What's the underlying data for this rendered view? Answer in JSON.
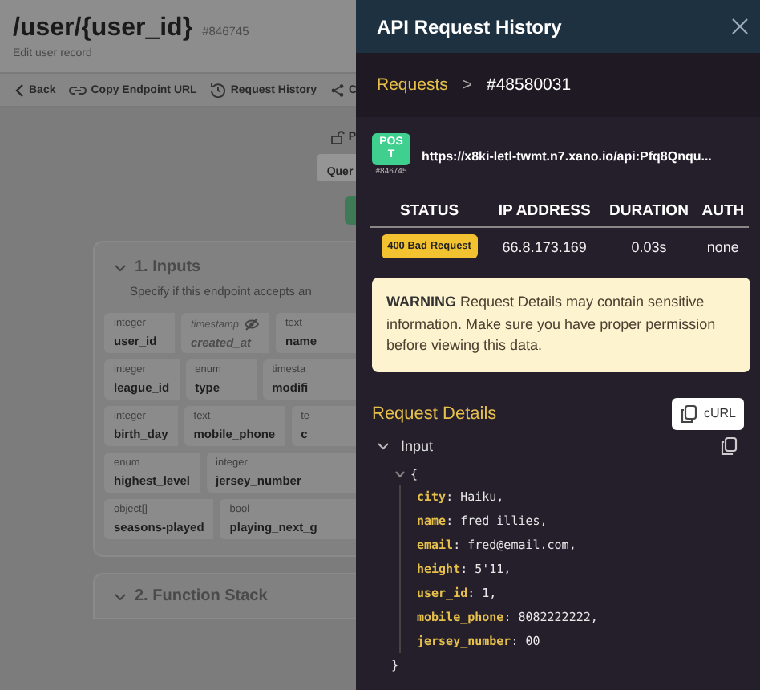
{
  "editor": {
    "title": "/user/{user_id}",
    "id": "#846745",
    "subtitle": "Edit user record",
    "toolbar": [
      {
        "kind": "back",
        "label": "Back"
      },
      {
        "kind": "link",
        "label": "Copy Endpoint URL"
      },
      {
        "kind": "history",
        "label": "Request History"
      },
      {
        "kind": "share",
        "label": "C"
      }
    ],
    "lock_label": "P",
    "tab_label": "Quer",
    "inputs": {
      "title": "1. Inputs",
      "description": "Specify if this endpoint accepts an",
      "field_rows": [
        [
          {
            "type": "integer",
            "name": "user_id",
            "hidden": false
          },
          {
            "type": "timestamp",
            "name": "created_at",
            "hidden": true
          },
          {
            "type": "text",
            "name": "name",
            "hidden": false
          }
        ],
        [
          {
            "type": "integer",
            "name": "league_id",
            "hidden": false
          },
          {
            "type": "enum",
            "name": "type",
            "hidden": false
          },
          {
            "type": "timesta",
            "name": "modifi",
            "hidden": false
          }
        ],
        [
          {
            "type": "integer",
            "name": "birth_day",
            "hidden": false
          },
          {
            "type": "text",
            "name": "mobile_phone",
            "hidden": false
          },
          {
            "type": "te",
            "name": "c",
            "hidden": false
          }
        ],
        [
          {
            "type": "enum",
            "name": "highest_level",
            "hidden": false
          },
          {
            "type": "integer",
            "name": "jersey_number",
            "hidden": false
          }
        ],
        [
          {
            "type": "object[]",
            "name": "seasons-played",
            "hidden": false
          },
          {
            "type": "bool",
            "name": "playing_next_g",
            "hidden": false
          }
        ]
      ]
    },
    "next_section": "2. Function Stack"
  },
  "drawer": {
    "title": "API Request History",
    "breadcrumb": {
      "parent": "Requests",
      "separator": ">",
      "current": "#48580031"
    },
    "request": {
      "method": "POST",
      "id": "#846745",
      "url": "https://x8ki-letl-twmt.n7.xano.io/api:Pfq8Qnqu..."
    },
    "table": {
      "columns": [
        "STATUS",
        "IP ADDRESS",
        "DURATION",
        "AUTH"
      ],
      "row": {
        "status": "400 Bad Request",
        "ip": "66.8.173.169",
        "duration": "0.03s",
        "auth": "none"
      }
    },
    "warning": "**WARNING** Request Details may contain sensitive information. Make sure you have proper permission before viewing this data.",
    "details": {
      "title": "Request Details",
      "curl_label": "cURL",
      "input_label": "Input",
      "input_expanded": true,
      "open_brace": "{",
      "close_brace": "}",
      "lines": [
        "**city**: Haiku,",
        "**name**: fred illies,",
        "**email**: fred@email.com,",
        "**height**: 5'11,",
        "**user_id**: 1,",
        "**mobile_phone**: 8082222222,",
        "**jersey_number**: 00"
      ]
    }
  }
}
